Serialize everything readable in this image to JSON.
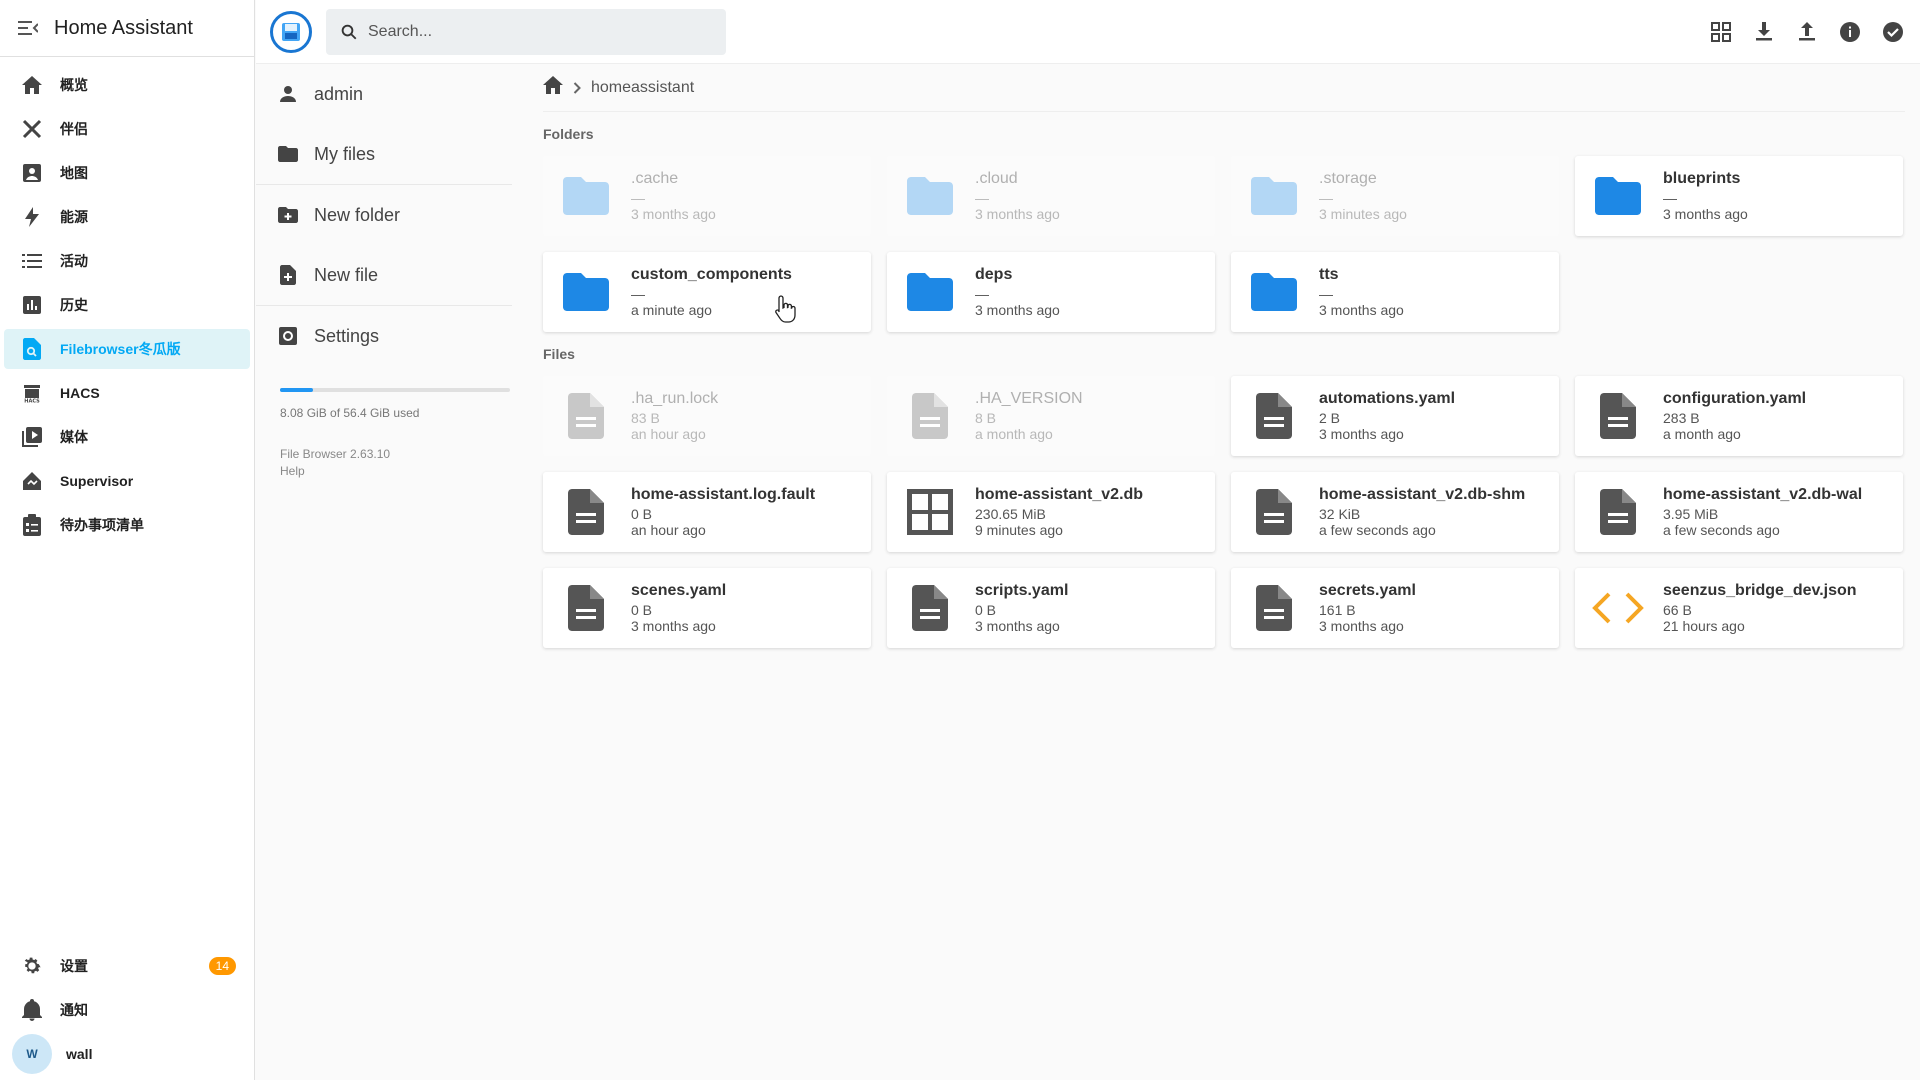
{
  "app": {
    "title": "Home Assistant"
  },
  "ha_nav": [
    {
      "label": "概览",
      "icon": "home-icon"
    },
    {
      "label": "伴侣",
      "icon": "tools-icon"
    },
    {
      "label": "地图",
      "icon": "map-icon"
    },
    {
      "label": "能源",
      "icon": "lightning-icon"
    },
    {
      "label": "活动",
      "icon": "list-icon"
    },
    {
      "label": "历史",
      "icon": "chart-icon"
    },
    {
      "label": "Filebrowser冬瓜版",
      "icon": "file-search-icon",
      "active": true
    },
    {
      "label": "HACS",
      "icon": "hacs-icon"
    },
    {
      "label": "媒体",
      "icon": "media-icon"
    },
    {
      "label": "Supervisor",
      "icon": "supervisor-icon"
    },
    {
      "label": "待办事项清单",
      "icon": "clipboard-icon"
    }
  ],
  "ha_bottom": {
    "settings_label": "设置",
    "settings_badge": "14",
    "notifications_label": "通知",
    "user_initial": "W",
    "user_name": "wall"
  },
  "topbar": {
    "search_placeholder": "Search...",
    "actions": [
      "grid-view-icon",
      "download-icon",
      "upload-icon",
      "info-icon",
      "check-circle-icon"
    ]
  },
  "fb_sidebar": {
    "user": "admin",
    "my_files": "My files",
    "new_folder": "New folder",
    "new_file": "New file",
    "settings": "Settings",
    "usage_text": "8.08 GiB of 56.4 GiB used",
    "usage_fraction": 0.143,
    "version": "File Browser 2.63.10",
    "help": "Help"
  },
  "breadcrumb": {
    "current": "homeassistant"
  },
  "sections": {
    "folders": "Folders",
    "files": "Files"
  },
  "folders": [
    {
      "name": ".cache",
      "size": "—",
      "modified": "3 months ago",
      "hidden": true
    },
    {
      "name": ".cloud",
      "size": "—",
      "modified": "3 months ago",
      "hidden": true
    },
    {
      "name": ".storage",
      "size": "—",
      "modified": "3 minutes ago",
      "hidden": true
    },
    {
      "name": "blueprints",
      "size": "—",
      "modified": "3 months ago",
      "hidden": false
    },
    {
      "name": "custom_components",
      "size": "—",
      "modified": "a minute ago",
      "hidden": false
    },
    {
      "name": "deps",
      "size": "—",
      "modified": "3 months ago",
      "hidden": false
    },
    {
      "name": "tts",
      "size": "—",
      "modified": "3 months ago",
      "hidden": false
    }
  ],
  "files": [
    {
      "name": ".ha_run.lock",
      "size": "83 B",
      "modified": "an hour ago",
      "hidden": true,
      "icon": "file-icon"
    },
    {
      "name": ".HA_VERSION",
      "size": "8 B",
      "modified": "a month ago",
      "hidden": true,
      "icon": "file-icon"
    },
    {
      "name": "automations.yaml",
      "size": "2 B",
      "modified": "3 months ago",
      "hidden": false,
      "icon": "file-icon"
    },
    {
      "name": "configuration.yaml",
      "size": "283 B",
      "modified": "a month ago",
      "hidden": false,
      "icon": "file-icon"
    },
    {
      "name": "home-assistant.log.fault",
      "size": "0 B",
      "modified": "an hour ago",
      "hidden": false,
      "icon": "file-icon"
    },
    {
      "name": "home-assistant_v2.db",
      "size": "230.65 MiB",
      "modified": "9 minutes ago",
      "hidden": false,
      "icon": "database-icon"
    },
    {
      "name": "home-assistant_v2.db-shm",
      "size": "32 KiB",
      "modified": "a few seconds ago",
      "hidden": false,
      "icon": "file-icon"
    },
    {
      "name": "home-assistant_v2.db-wal",
      "size": "3.95 MiB",
      "modified": "a few seconds ago",
      "hidden": false,
      "icon": "file-icon"
    },
    {
      "name": "scenes.yaml",
      "size": "0 B",
      "modified": "3 months ago",
      "hidden": false,
      "icon": "file-icon"
    },
    {
      "name": "scripts.yaml",
      "size": "0 B",
      "modified": "3 months ago",
      "hidden": false,
      "icon": "file-icon"
    },
    {
      "name": "secrets.yaml",
      "size": "161 B",
      "modified": "3 months ago",
      "hidden": false,
      "icon": "file-icon"
    },
    {
      "name": "seenzus_bridge_dev.json",
      "size": "66 B",
      "modified": "21 hours ago",
      "hidden": false,
      "icon": "code-icon"
    }
  ],
  "colors": {
    "accent": "#03a9f4",
    "folder": "#1e88e5",
    "folder_hidden": "#b3d7f5",
    "file": "#555555",
    "file_hidden": "#c8c8c8",
    "code": "#f5a623",
    "badge": "#ff9800"
  }
}
